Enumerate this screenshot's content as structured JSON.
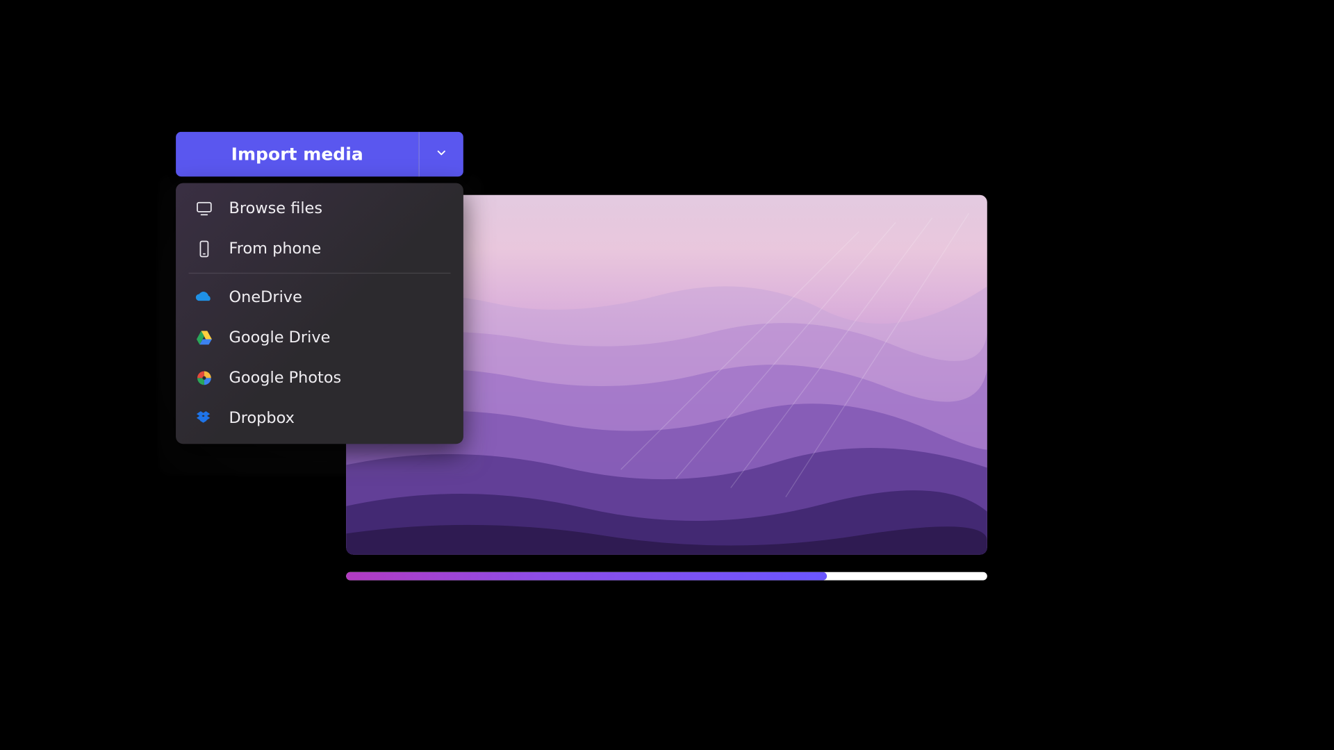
{
  "split_button": {
    "main_label": "Import media"
  },
  "dropdown": {
    "items": [
      {
        "label": "Browse files"
      },
      {
        "label": "From phone"
      },
      {
        "label": "OneDrive"
      },
      {
        "label": "Google Drive"
      },
      {
        "label": "Google Photos"
      },
      {
        "label": "Dropbox"
      }
    ]
  },
  "progress": {
    "percent": 75
  },
  "colors": {
    "accent": "#5a57ef",
    "dropdown_bg": "#2c2a2e"
  }
}
